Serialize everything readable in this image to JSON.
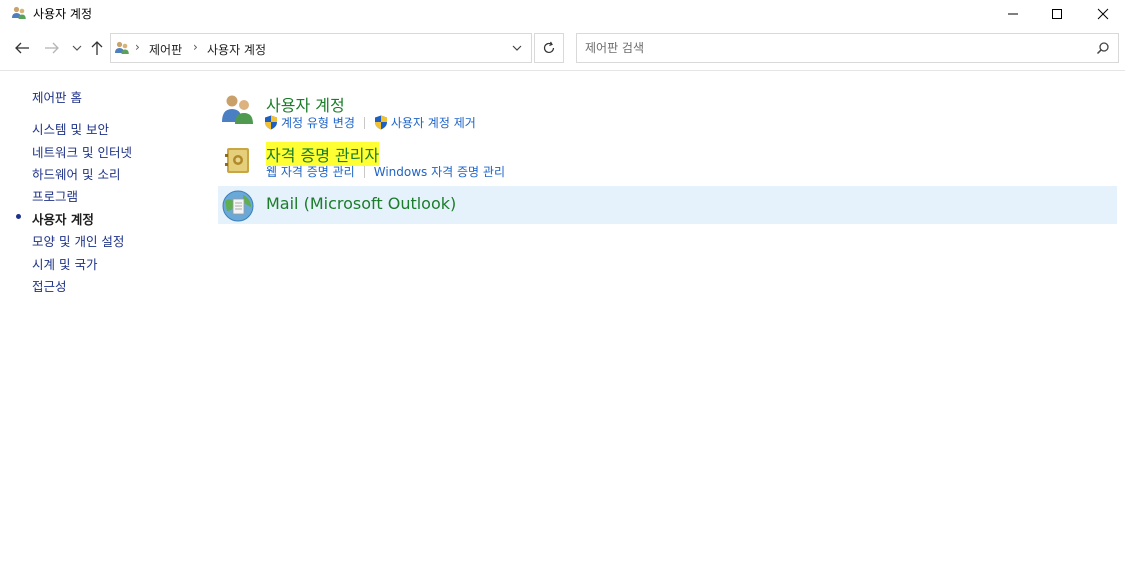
{
  "window": {
    "title": "사용자 계정"
  },
  "nav": {
    "breadcrumb": [
      "제어판",
      "사용자 계정"
    ],
    "search_placeholder": "제어판 검색"
  },
  "sidebar": {
    "home": "제어판 홈",
    "items": [
      {
        "label": "시스템 및 보안",
        "active": false
      },
      {
        "label": "네트워크 및 인터넷",
        "active": false
      },
      {
        "label": "하드웨어 및 소리",
        "active": false
      },
      {
        "label": "프로그램",
        "active": false
      },
      {
        "label": "사용자 계정",
        "active": true
      },
      {
        "label": "모양 및 개인 설정",
        "active": false
      },
      {
        "label": "시계 및 국가",
        "active": false
      },
      {
        "label": "접근성",
        "active": false
      }
    ]
  },
  "main": {
    "categories": [
      {
        "title": "사용자 계정",
        "icon": "user-accounts-icon",
        "links": [
          "계정 유형 변경",
          "사용자 계정 제거"
        ]
      },
      {
        "title": "자격 증명 관리자",
        "icon": "credential-manager-icon",
        "highlighted": true,
        "links": [
          "웹 자격 증명 관리",
          "Windows 자격 증명 관리"
        ]
      },
      {
        "title": "Mail (Microsoft Outlook)",
        "icon": "mail-icon",
        "hovered": true,
        "links": []
      }
    ]
  },
  "colors": {
    "link": "#1e64c8",
    "category_title": "#1b7d2a",
    "sidebar_link": "#1e3287",
    "highlight": "#ffff33",
    "hover_row": "#e5f1fb"
  }
}
